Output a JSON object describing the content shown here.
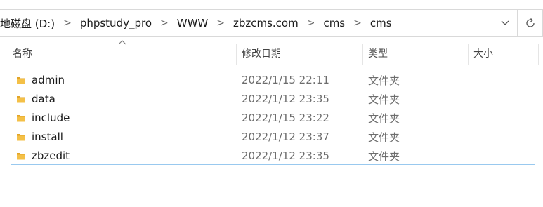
{
  "address_bar": {
    "crumbs": [
      "地磁盘 (D:)",
      "phpstudy_pro",
      "WWW",
      "zbzcms.com",
      "cms",
      "cms"
    ],
    "separator": ">",
    "dropdown_icon": "chevron-down-icon",
    "refresh_icon": "refresh-icon"
  },
  "columns": {
    "name": "名称",
    "modified": "修改日期",
    "type": "类型",
    "size": "大小",
    "sort_indicator": "sort-ascending-icon"
  },
  "files": [
    {
      "name": "admin",
      "modified": "2022/1/15 22:11",
      "type": "文件夹",
      "icon": "folder-icon"
    },
    {
      "name": "data",
      "modified": "2022/1/12 23:35",
      "type": "文件夹",
      "icon": "folder-icon"
    },
    {
      "name": "include",
      "modified": "2022/1/15 23:22",
      "type": "文件夹",
      "icon": "folder-icon"
    },
    {
      "name": "install",
      "modified": "2022/1/12 23:37",
      "type": "文件夹",
      "icon": "folder-icon"
    },
    {
      "name": "zbzedit",
      "modified": "2022/1/12 23:35",
      "type": "文件夹",
      "icon": "folder-icon",
      "selected": true
    }
  ],
  "colors": {
    "folder": "#f4c047",
    "folder_dark": "#e2a529",
    "selection_border": "#99c9ef"
  }
}
